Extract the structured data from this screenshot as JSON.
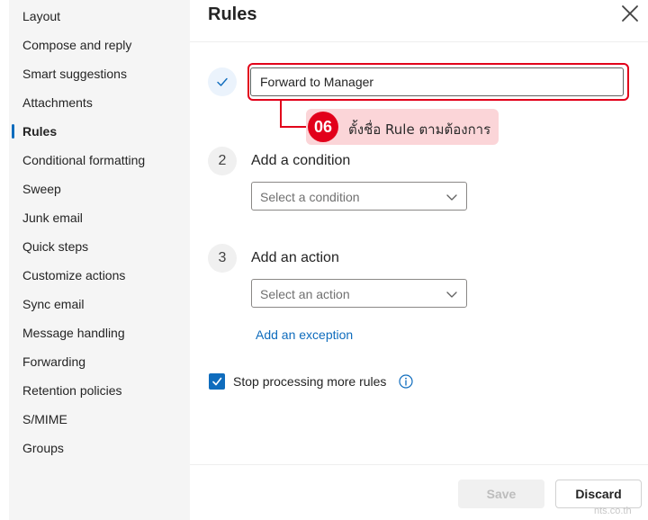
{
  "sidebar": {
    "items": [
      {
        "label": "Layout",
        "active": false
      },
      {
        "label": "Compose and reply",
        "active": false
      },
      {
        "label": "Smart suggestions",
        "active": false
      },
      {
        "label": "Attachments",
        "active": false
      },
      {
        "label": "Rules",
        "active": true
      },
      {
        "label": "Conditional formatting",
        "active": false
      },
      {
        "label": "Sweep",
        "active": false
      },
      {
        "label": "Junk email",
        "active": false
      },
      {
        "label": "Quick steps",
        "active": false
      },
      {
        "label": "Customize actions",
        "active": false
      },
      {
        "label": "Sync email",
        "active": false
      },
      {
        "label": "Message handling",
        "active": false
      },
      {
        "label": "Forwarding",
        "active": false
      },
      {
        "label": "Retention policies",
        "active": false
      },
      {
        "label": "S/MIME",
        "active": false
      },
      {
        "label": "Groups",
        "active": false
      }
    ]
  },
  "panel": {
    "title": "Rules",
    "close_icon": "close-icon"
  },
  "rule_name": {
    "step_icon": "checkmark-icon",
    "value": "Forward to Manager"
  },
  "annotation": {
    "number": "06",
    "text": "ตั้งชื่อ Rule ตามต้องการ"
  },
  "condition": {
    "step": "2",
    "label": "Add a condition",
    "placeholder": "Select a condition"
  },
  "action": {
    "step": "3",
    "label": "Add an action",
    "placeholder": "Select an action"
  },
  "exception_link": "Add an exception",
  "stop_processing": {
    "label": "Stop processing more rules",
    "checked": true,
    "info_icon": "info-icon"
  },
  "footer": {
    "save_label": "Save",
    "discard_label": "Discard"
  },
  "watermark": "nts.co.th",
  "colors": {
    "accent": "#0f6cbd",
    "annotation_red": "#e2001a",
    "annotation_bg": "#fbd5d8",
    "sidebar_bg": "#f5f5f5"
  }
}
